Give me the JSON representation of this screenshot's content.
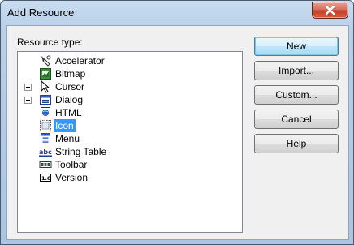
{
  "window": {
    "title": "Add Resource"
  },
  "tree": {
    "label": "Resource type:",
    "items": [
      {
        "label": "Accelerator",
        "icon": "accelerator-icon",
        "expandable": false
      },
      {
        "label": "Bitmap",
        "icon": "bitmap-icon",
        "expandable": false
      },
      {
        "label": "Cursor",
        "icon": "cursor-icon",
        "expandable": true
      },
      {
        "label": "Dialog",
        "icon": "dialog-icon",
        "expandable": true
      },
      {
        "label": "HTML",
        "icon": "html-icon",
        "expandable": false
      },
      {
        "label": "Icon",
        "icon": "icon-resource-icon",
        "expandable": false,
        "selected": true
      },
      {
        "label": "Menu",
        "icon": "menu-icon",
        "expandable": false
      },
      {
        "label": "String Table",
        "icon": "string-table-icon",
        "expandable": false
      },
      {
        "label": "Toolbar",
        "icon": "toolbar-icon",
        "expandable": false
      },
      {
        "label": "Version",
        "icon": "version-icon",
        "expandable": false
      }
    ]
  },
  "buttons": {
    "new": "New",
    "import": "Import...",
    "custom": "Custom...",
    "cancel": "Cancel",
    "help": "Help"
  }
}
